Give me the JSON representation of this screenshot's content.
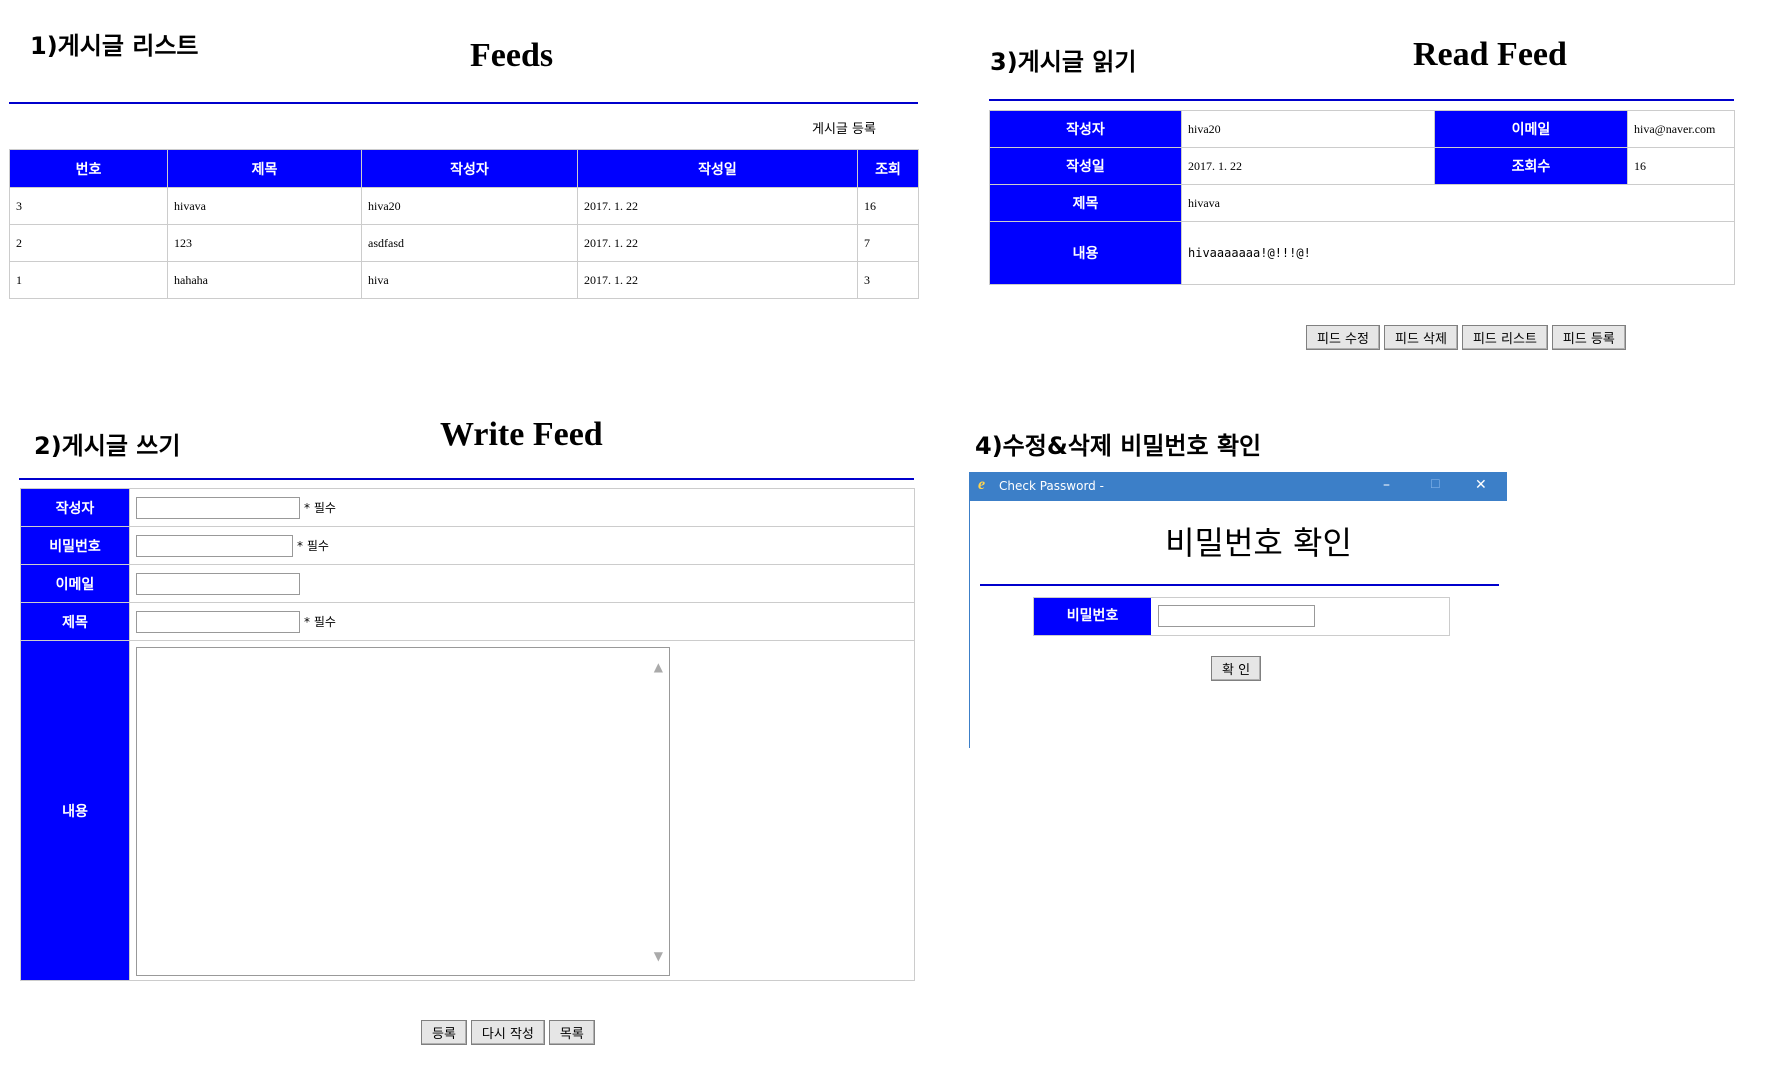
{
  "sections": {
    "list_label": "1)게시글 리스트",
    "write_label": "2)게시글 쓰기",
    "read_label": "3)게시글 읽기",
    "pw_label": "4)수정&삭제 비밀번호 확인"
  },
  "feeds": {
    "title": "Feeds",
    "register_link": "게시글 등록",
    "columns": [
      "번호",
      "제목",
      "작성자",
      "작성일",
      "조회"
    ],
    "rows": [
      [
        "3",
        "hivava",
        "hiva20",
        "2017. 1. 22",
        "16"
      ],
      [
        "2",
        "123",
        "asdfasd",
        "2017. 1. 22",
        "7"
      ],
      [
        "1",
        "hahaha",
        "hiva",
        "2017. 1. 22",
        "3"
      ]
    ]
  },
  "write": {
    "title": "Write Feed",
    "labels": {
      "author": "작성자",
      "password": "비밀번호",
      "email": "이메일",
      "subject": "제목",
      "content": "내용"
    },
    "required": "* 필수",
    "buttons": {
      "submit": "등록",
      "reset": "다시 작성",
      "list": "목록"
    }
  },
  "read": {
    "title": "Read Feed",
    "labels": {
      "author": "작성자",
      "email": "이메일",
      "date": "작성일",
      "views": "조회수",
      "subject": "제목",
      "content": "내용"
    },
    "values": {
      "author": "hiva20",
      "email": "hiva@naver.com",
      "date": "2017. 1. 22",
      "views": "16",
      "subject": "hivava",
      "content": "hivaaaaaaa!@!!!@!"
    },
    "buttons": {
      "edit": "피드 수정",
      "delete": "피드 삭제",
      "list": "피드 리스트",
      "register": "피드 등록"
    }
  },
  "password_dialog": {
    "window_title": "Check Password -",
    "heading": "비밀번호 확인",
    "label": "비밀번호",
    "confirm": "확 인",
    "controls": {
      "minimize": "–",
      "maximize": "☐",
      "close": "✕"
    }
  },
  "colors": {
    "accent": "#0000ff",
    "rule": "#0000cc",
    "titlebar": "#3c7fc8"
  },
  "icons": {
    "browser": "ie-icon",
    "scroll_up": "chevron-up-icon",
    "scroll_down": "chevron-down-icon"
  }
}
